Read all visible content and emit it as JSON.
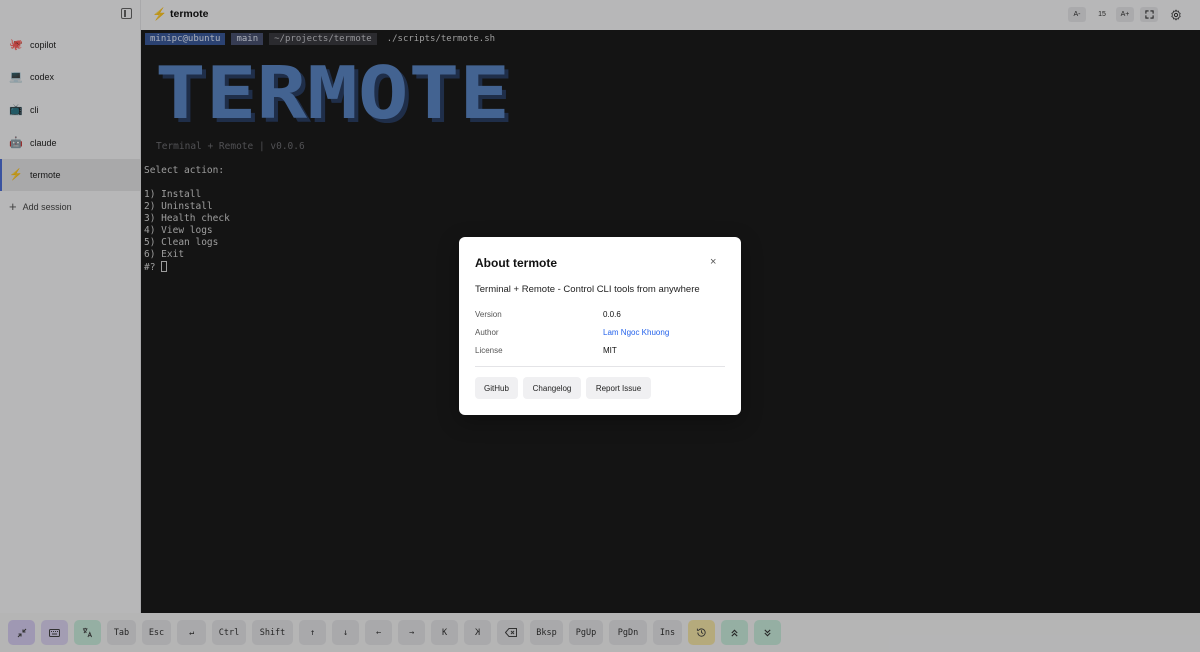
{
  "sidebar": {
    "sessions": [
      {
        "icon": "🐙",
        "label": "copilot"
      },
      {
        "icon": "💻",
        "label": "codex"
      },
      {
        "icon": "📺",
        "label": "cli"
      },
      {
        "icon": "🤖",
        "label": "claude"
      },
      {
        "icon": "⚡",
        "label": "termote",
        "active": true
      }
    ],
    "add_label": "Add session"
  },
  "header": {
    "icon": "⚡",
    "title": "termote",
    "font_decrease": "A-",
    "font_size": "15",
    "font_increase": "A+"
  },
  "terminal": {
    "prompt": {
      "host": "minipc@ubuntu",
      "branch": "main",
      "path": "~/projects/termote",
      "command": "./scripts/termote.sh"
    },
    "banner_text": "TERMOTE",
    "subtitle": "Terminal + Remote | v0.0.6",
    "select_prompt": "Select action:",
    "options": [
      "1) Install",
      "2) Uninstall",
      "3) Health check",
      "4) View logs",
      "5) Clean logs",
      "6) Exit"
    ],
    "input_prompt": "#?"
  },
  "dialog": {
    "title": "About termote",
    "close": "×",
    "description": "Terminal + Remote - Control CLI tools from anywhere",
    "rows": [
      {
        "label": "Version",
        "value": "0.0.6"
      },
      {
        "label": "Author",
        "value": "Lam Ngoc Khuong"
      },
      {
        "label": "License",
        "value": "MIT"
      }
    ],
    "buttons": [
      "GitHub",
      "Changelog",
      "Report Issue"
    ]
  },
  "toolbar": {
    "keys": [
      "Tab",
      "Esc",
      "Ctrl",
      "Shift",
      "Bksp",
      "PgUp",
      "PgDn",
      "Ins"
    ],
    "enter": "↵",
    "up": "↑",
    "down": "↓",
    "left": "←",
    "right": "→",
    "home": "K",
    "end": "K"
  },
  "colors": {
    "accent": "#4d6fd8",
    "banner": "#5b86c4",
    "terminal_bg": "#1b1b1b",
    "link": "#2563eb"
  }
}
